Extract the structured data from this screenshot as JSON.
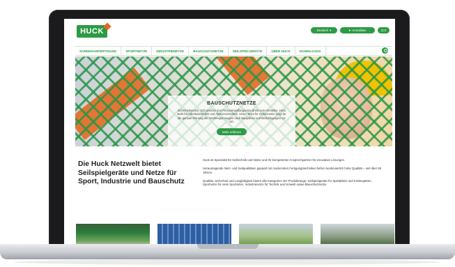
{
  "header": {
    "logo_text": "HUCK",
    "language_button": "Deutsch",
    "account_button": "Anmelden",
    "cart_button": "0"
  },
  "nav": {
    "items": [
      "SONDERANFERTIGUNG",
      "SPORTNETZE",
      "INDUSTRIENETZE",
      "BAUSCHUTZNETZE",
      "SEILSPIELGERÄTE",
      "ÜBER HUCK",
      "DOWNLOADS"
    ]
  },
  "hero": {
    "title": "BAUSCHUTZNETZE",
    "text": "Sicherheitsnetze, Schutznetze und Personenauffangnetze direkt vom Hersteller. Huck steht für Arbeitssicherheit und Absturzsicherheit. Unser Team für Schutznetze sorgt für die genaue Planung der Netzbespannungen nach Bauplänen und Besichtigungen vor Ort.",
    "button": "Mehr erfahren"
  },
  "intro": {
    "heading": "Die Huck Netzwelt bietet Seilspielgeräte und Netze für Sport, Industrie und Bauschutz",
    "paragraphs": [
      "Huck ist Spezialist für Seiltechnik und Netze und Ihr kompetenter Ansprechpartner für innovative Lösungen.",
      "Herausragende Netz- und Seilqualitäten gepaart mit modernsten Fertigungstechniken liefern kontinuierlich hohe Qualität – seit über 55 Jahren.",
      "Qualität, Sicherheit und Langlebigkeit bieten alle Kategorien der Produktrange: Seilspielgeräte für Spielplätze und Kindergärten, Sportnetze für viele Sportarten, Industrienetze für Technik und Umwelt sowie Bauschutznetze."
    ]
  },
  "colors": {
    "brand_green": "#2d9a45",
    "accent_orange": "#e46a23",
    "helmet_yellow": "#f1c200"
  },
  "icons": [
    "search-icon",
    "cart-icon",
    "user-icon",
    "chevron-down-icon"
  ]
}
